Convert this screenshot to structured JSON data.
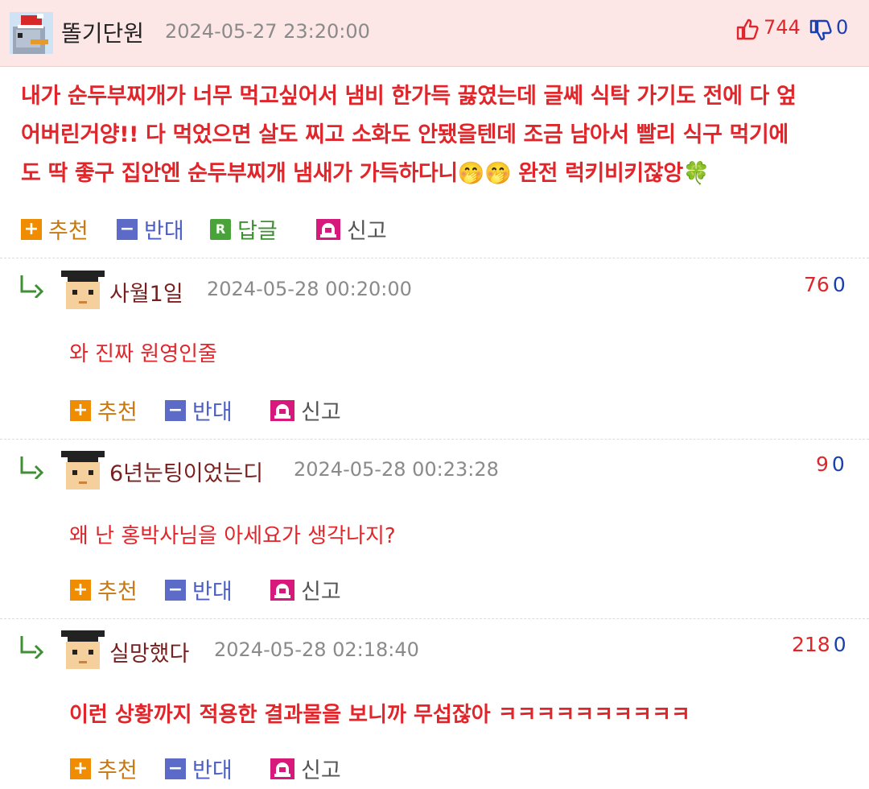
{
  "post": {
    "author": "똘기단원",
    "timestamp": "2024-05-27 23:20:00",
    "upvotes": "744",
    "downvotes": "0",
    "lines": [
      "내가 순두부찌개가 너무 먹고싶어서 냄비 한가득 끓였는데 글쎄 식탁 가기도 전에 다 엎",
      "어버린거양!! 다 먹었으면 살도 찌고 소화도 안됐을텐데 조금 남아서 빨리 식구 먹기에",
      "도 딱 좋구 집안엔 순두부찌개 냄새가 가득하다니🤭🤭 완전 럭키비키잖앙🍀"
    ],
    "actions": {
      "recommend": "추천",
      "oppose": "반대",
      "reply": "답글",
      "report": "신고"
    }
  },
  "comments": [
    {
      "author": "사월1일",
      "timestamp": "2024-05-28 00:20:00",
      "up": "76",
      "down": "0",
      "text": "와 진짜 원영인줄"
    },
    {
      "author": "6년눈팅이었는디",
      "timestamp": "2024-05-28 00:23:28",
      "up": "9",
      "down": "0",
      "text": "왜 난 홍박사님을 아세요가 생각나지?"
    },
    {
      "author": "실망했다",
      "timestamp": "2024-05-28 02:18:40",
      "up": "218",
      "down": "0",
      "text": "이런 상황까지 적용한 결과물을 보니까 무섭잖아 ㅋㅋㅋㅋㅋㅋㅋㅋㅋㅋ"
    }
  ],
  "comment_actions": {
    "recommend": "추천",
    "oppose": "반대",
    "report": "신고"
  },
  "icons": {
    "recommend": "plus-square-icon",
    "oppose": "minus-square-icon",
    "reply": "r-square-icon",
    "report": "siren-icon",
    "thumb_up": "thumbs-up-icon",
    "thumb_down": "thumbs-down-icon"
  },
  "colors": {
    "accent_red": "#e0262b",
    "downvote_blue": "#1a3fb0",
    "header_pink": "#fde6e6"
  }
}
